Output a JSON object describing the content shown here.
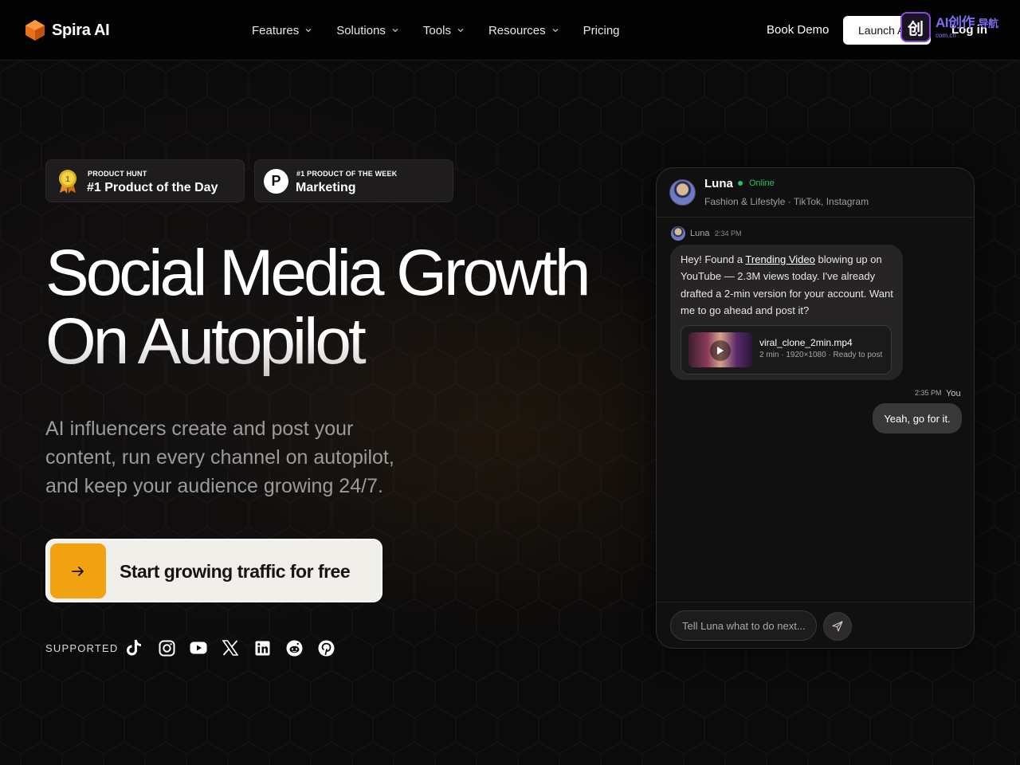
{
  "colors": {
    "accent": "#f2a111",
    "online": "#22c55e",
    "background": "#0c0b0b",
    "cta_bg": "#f1efe9"
  },
  "nav": {
    "brand": "Spira AI",
    "links": [
      {
        "label": "Features",
        "has_dropdown": true
      },
      {
        "label": "Solutions",
        "has_dropdown": true
      },
      {
        "label": "Tools",
        "has_dropdown": true
      },
      {
        "label": "Resources",
        "has_dropdown": true
      },
      {
        "label": "Pricing",
        "has_dropdown": false
      }
    ],
    "book_demo": "Book Demo",
    "launch": "Launch App",
    "login": "Log in"
  },
  "watermark": {
    "glyph": "创",
    "text": "AI创作",
    "small": "导航",
    "domain": "com.cn"
  },
  "badges": [
    {
      "kicker": "PRODUCT HUNT",
      "title": "#1 Product of the Day",
      "icon": "medal-icon"
    },
    {
      "kicker": "#1 PRODUCT OF THE WEEK",
      "title": "Marketing",
      "icon": "product-hunt-icon",
      "glyph": "P"
    }
  ],
  "hero": {
    "title_line1": "Social Media Growth",
    "title_line2": "On Autopilot",
    "subtitle": "AI influencers create and post your content, run every channel on autopilot, and keep your audience growing 24/7.",
    "cta": "Start growing traffic for free"
  },
  "supported": {
    "label": "SUPPORTED",
    "platforms": [
      "tiktok-icon",
      "instagram-icon",
      "youtube-icon",
      "x-icon",
      "linkedin-icon",
      "reddit-icon",
      "pinterest-icon"
    ]
  },
  "chat": {
    "name": "Luna",
    "status": "Online",
    "niche": "Fashion & Lifestyle · TikTok, Instagram",
    "incoming": {
      "sender": "Luna",
      "time": "2:34 PM",
      "text_before": "Hey! Found a ",
      "link": "Trending Video",
      "text_after": " blowing up on YouTube — 2.3M views today. I've already drafted a 2-min version for your account. Want me to go ahead and post it?",
      "attachment": {
        "file": "viral_clone_2min.mp4",
        "meta": "2 min · 1920×1080 · Ready to post"
      }
    },
    "outgoing": {
      "sender": "You",
      "time": "2:35 PM",
      "text": "Yeah, go for it."
    },
    "input_placeholder": "Tell Luna what to do next..."
  }
}
